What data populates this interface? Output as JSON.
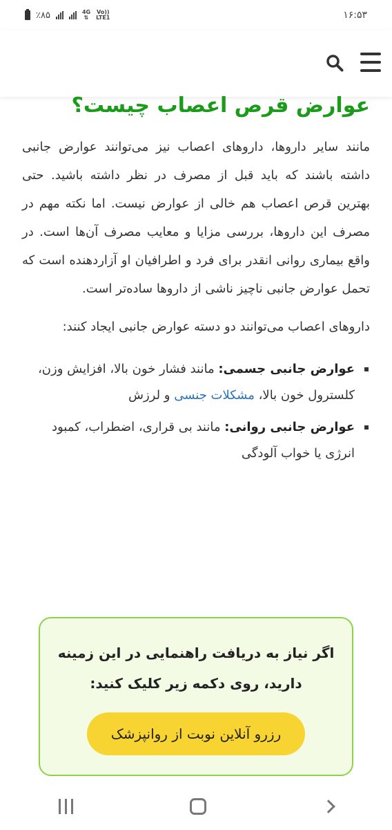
{
  "status_bar": {
    "time": "۱۶:۵۳",
    "battery": "٪۸۵",
    "network_top": "4G",
    "network_bottom": "LTE1",
    "volte_label": "Vo))"
  },
  "article": {
    "title": "عوارض قرص اعصاب چیست؟",
    "paragraph1": "مانند سایر داروها، داروهای اعصاب نیز می‌توانند عوارض جانبی داشته باشند که باید قبل از مصرف در نظر داشته باشید. حتی بهترین قرص اعصاب هم خالی از عوارض نیست. اما نکته مهم در مصرف این داروها، بررسی مزایا و معایب مصرف آن‌ها است. در واقع بیماری روانی انقدر برای فرد و اطرافیان او آزاردهنده است که تحمل عوارض جانبی ناچیز ناشی از داروها ساده‌تر است.",
    "paragraph2": "داروهای اعصاب می‌توانند دو دسته عوارض جانبی ایجاد کنند:",
    "bullets": [
      {
        "label": "عوارض جانبی جسمی:",
        "text": " مانند فشار خون بالا، افزایش وزن، کلسترول خون بالا، ",
        "link": "مشکلات جنسی",
        "tail": " و لرزش"
      },
      {
        "label": "عوارض جانبی روانی:",
        "text": " مانند بی قراری، اضطراب، کمبود انرژی یا خواب آلودگی"
      }
    ]
  },
  "cta": {
    "text": "اگر نیاز به دریافت راهنمایی در این زمینه دارید، روی دکمه زیر کلیک کنید:",
    "button_label": "رزرو آنلاین نوبت از روانپزشک"
  },
  "colors": {
    "title_green": "#1a9c1a",
    "link_blue": "#2a73b8",
    "cta_border": "#8ed14b",
    "cta_bg": "#f3fbe5",
    "button_yellow": "#f7d431"
  },
  "icons": {
    "menu": "hamburger-menu-icon",
    "search": "search-icon",
    "nav_recent": "recent-apps-icon",
    "nav_home": "home-icon",
    "nav_back": "back-icon"
  }
}
